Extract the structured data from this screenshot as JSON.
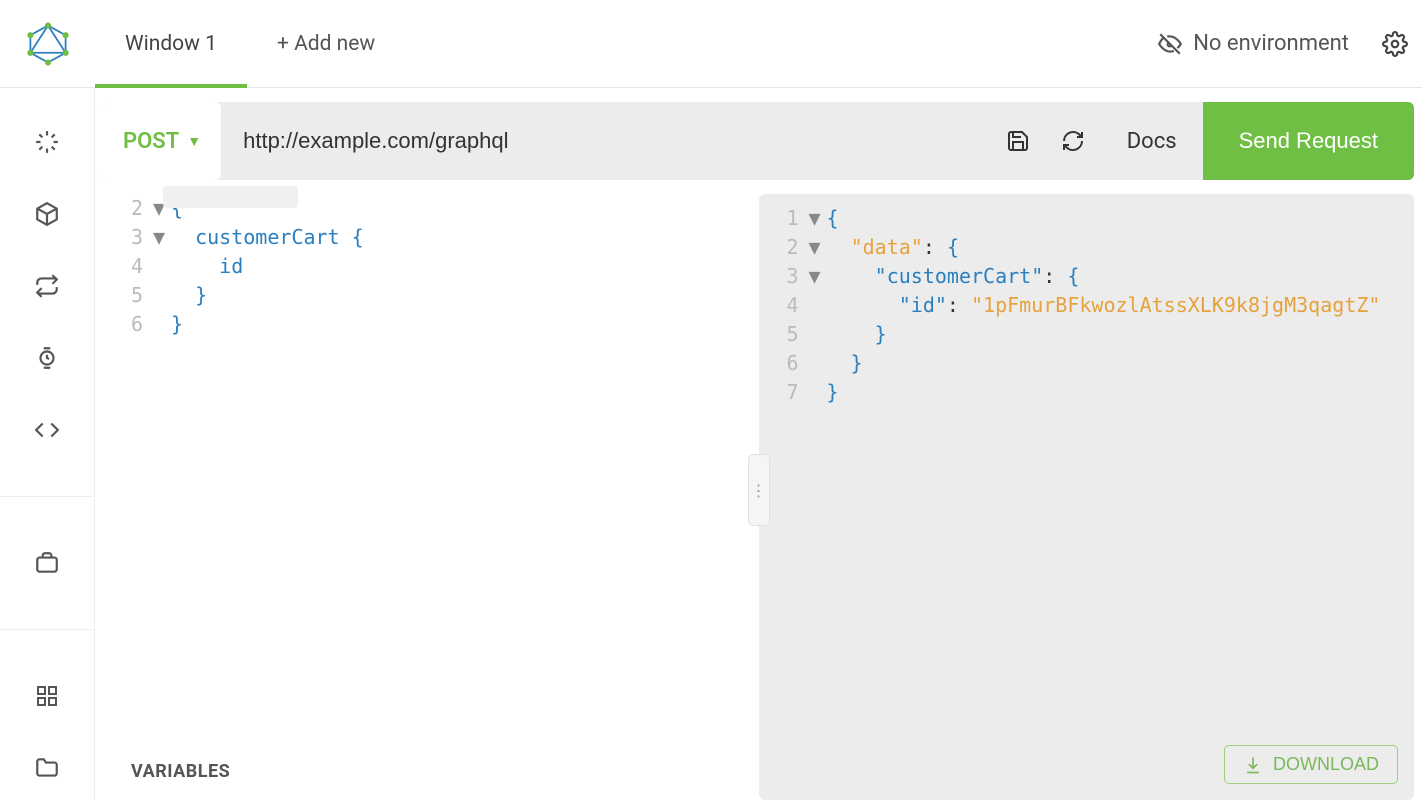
{
  "header": {
    "tabs": [
      {
        "label": "Window 1",
        "active": true
      }
    ],
    "add_new_label": "+ Add new",
    "env_label": "No environment"
  },
  "request": {
    "method": "POST",
    "url": "http://example.com/graphql",
    "docs_label": "Docs",
    "send_label": "Send Request"
  },
  "editor": {
    "lines": [
      {
        "n": "2",
        "fold": "▼",
        "tokens": [
          {
            "t": "brace",
            "v": "{"
          }
        ]
      },
      {
        "n": "3",
        "fold": "▼",
        "tokens": [
          {
            "t": "plain",
            "v": "  "
          },
          {
            "t": "field",
            "v": "customerCart"
          },
          {
            "t": "plain",
            "v": " "
          },
          {
            "t": "brace",
            "v": "{"
          }
        ]
      },
      {
        "n": "4",
        "fold": "",
        "tokens": [
          {
            "t": "plain",
            "v": "    "
          },
          {
            "t": "field",
            "v": "id"
          }
        ]
      },
      {
        "n": "5",
        "fold": "",
        "tokens": [
          {
            "t": "plain",
            "v": "  "
          },
          {
            "t": "brace",
            "v": "}"
          }
        ]
      },
      {
        "n": "6",
        "fold": "",
        "tokens": [
          {
            "t": "brace",
            "v": "}"
          }
        ]
      }
    ]
  },
  "response": {
    "lines": [
      {
        "n": "1",
        "fold": "▼",
        "tokens": [
          {
            "t": "brace",
            "v": "{"
          }
        ]
      },
      {
        "n": "2",
        "fold": "▼",
        "tokens": [
          {
            "t": "plain",
            "v": "  "
          },
          {
            "t": "dkey",
            "v": "\"data\""
          },
          {
            "t": "plain",
            "v": ": "
          },
          {
            "t": "brace",
            "v": "{"
          }
        ]
      },
      {
        "n": "3",
        "fold": "▼",
        "tokens": [
          {
            "t": "plain",
            "v": "    "
          },
          {
            "t": "key",
            "v": "\"customerCart\""
          },
          {
            "t": "plain",
            "v": ": "
          },
          {
            "t": "brace",
            "v": "{"
          }
        ]
      },
      {
        "n": "4",
        "fold": "",
        "tokens": [
          {
            "t": "plain",
            "v": "      "
          },
          {
            "t": "key",
            "v": "\"id\""
          },
          {
            "t": "plain",
            "v": ": "
          },
          {
            "t": "str",
            "v": "\"1pFmurBFkwozlAtssXLK9k8jgM3qagtZ\""
          }
        ]
      },
      {
        "n": "5",
        "fold": "",
        "tokens": [
          {
            "t": "plain",
            "v": "    "
          },
          {
            "t": "brace",
            "v": "}"
          }
        ]
      },
      {
        "n": "6",
        "fold": "",
        "tokens": [
          {
            "t": "plain",
            "v": "  "
          },
          {
            "t": "brace",
            "v": "}"
          }
        ]
      },
      {
        "n": "7",
        "fold": "",
        "tokens": [
          {
            "t": "brace",
            "v": "}"
          }
        ]
      }
    ],
    "download_label": "DOWNLOAD"
  },
  "bottom": {
    "variables_label": "VARIABLES"
  }
}
